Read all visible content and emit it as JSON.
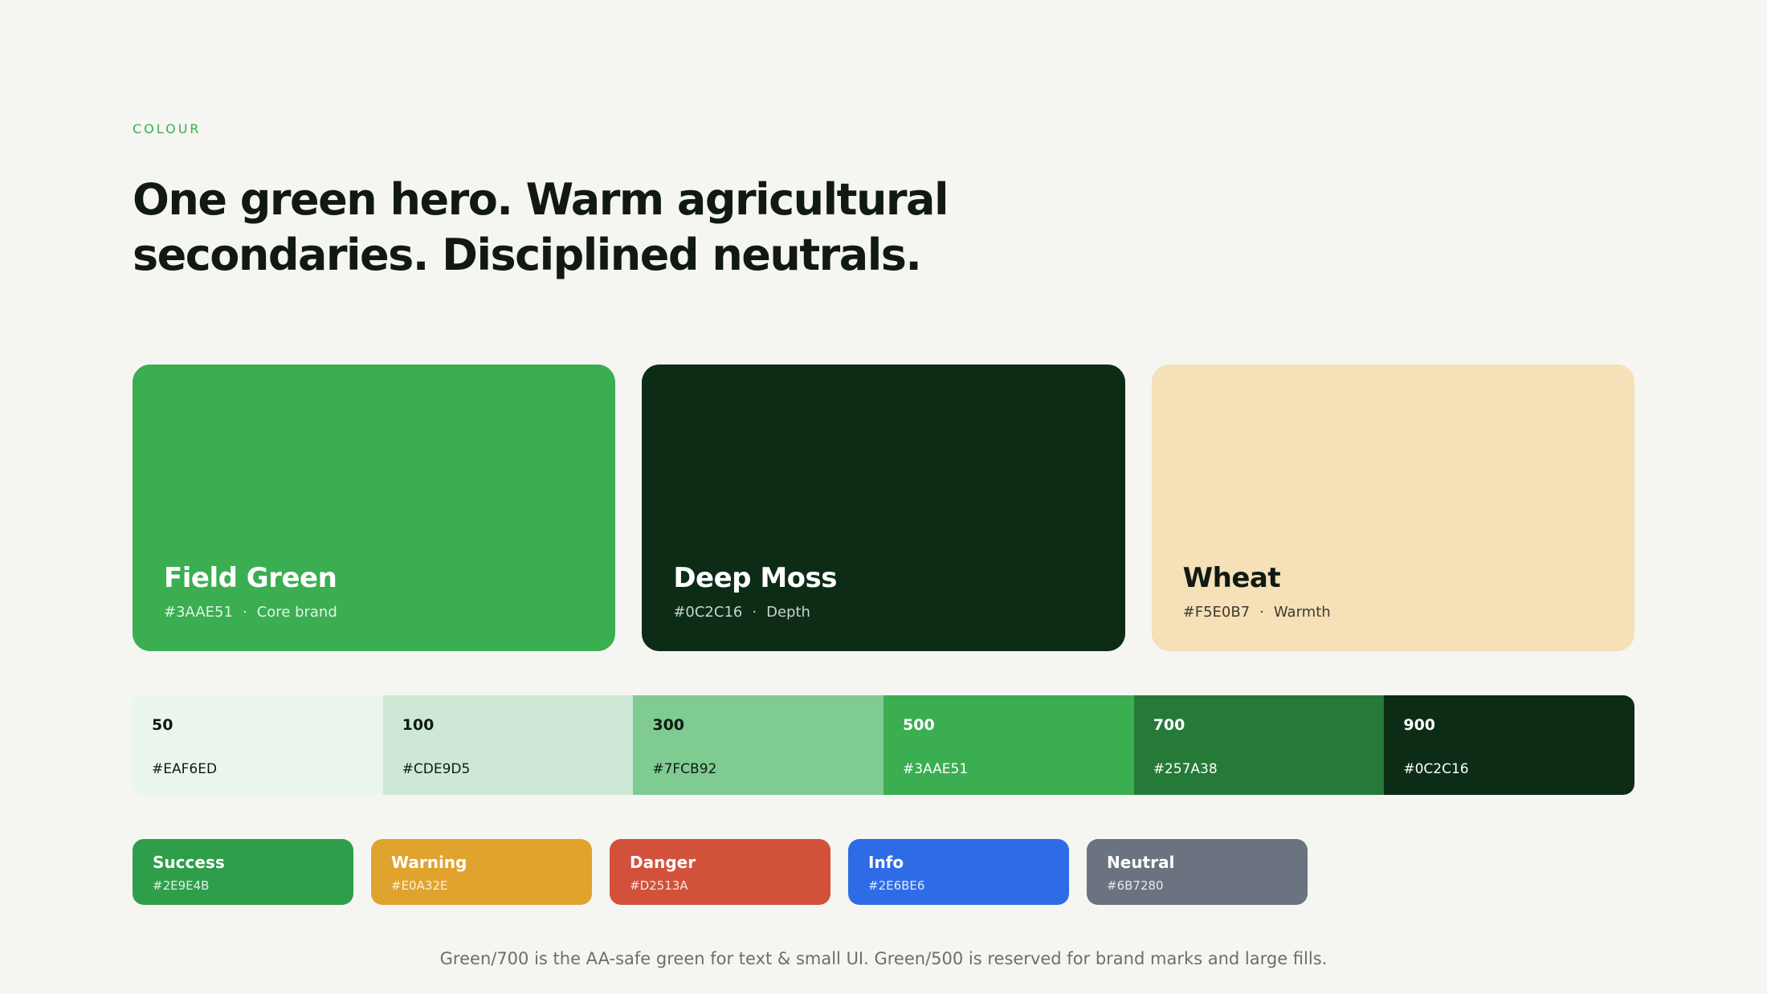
{
  "section": {
    "eyebrow": "COLOUR",
    "headline": "One green hero. Warm agricultural secondaries. Disciplined neutrals."
  },
  "hero_colors": [
    {
      "name": "Field Green",
      "hex": "#3AAE51",
      "role": "Core brand",
      "separator": "·",
      "bg": "#3AAE51",
      "text": "#FFFFFF",
      "meta_text": "#E3F4E6"
    },
    {
      "name": "Deep Moss",
      "hex": "#0C2C16",
      "role": "Depth",
      "separator": "·",
      "bg": "#0C2C16",
      "text": "#FFFFFF",
      "meta_text": "#C9D3CB"
    },
    {
      "name": "Wheat",
      "hex": "#F5E0B7",
      "role": "Warmth",
      "separator": "·",
      "bg": "#F5E0B7",
      "text": "#111A12",
      "meta_text": "#3F3A30"
    }
  ],
  "green_scale": [
    {
      "step": "50",
      "hex": "#EAF6ED",
      "bg": "#EAF6ED",
      "text": "#111A12"
    },
    {
      "step": "100",
      "hex": "#CDE9D5",
      "bg": "#CDE9D5",
      "text": "#111A12"
    },
    {
      "step": "300",
      "hex": "#7FCB92",
      "bg": "#7FCB92",
      "text": "#111A12"
    },
    {
      "step": "500",
      "hex": "#3AAE51",
      "bg": "#3AAE51",
      "text": "#FFFFFF"
    },
    {
      "step": "700",
      "hex": "#257A38",
      "bg": "#257A38",
      "text": "#FFFFFF"
    },
    {
      "step": "900",
      "hex": "#0C2C16",
      "bg": "#0C2C16",
      "text": "#FFFFFF"
    }
  ],
  "status_colors": [
    {
      "name": "Success",
      "hex": "#2E9E4B",
      "bg": "#2E9E4B"
    },
    {
      "name": "Warning",
      "hex": "#E0A32E",
      "bg": "#E0A32E"
    },
    {
      "name": "Danger",
      "hex": "#D2513A",
      "bg": "#D2513A"
    },
    {
      "name": "Info",
      "hex": "#2E6BE6",
      "bg": "#2E6BE6"
    },
    {
      "name": "Neutral",
      "hex": "#6B7280",
      "bg": "#6B7280"
    }
  ],
  "footnote": "Green/700 is the AA-safe green for text & small UI. Green/500 is reserved for brand marks and large fills."
}
